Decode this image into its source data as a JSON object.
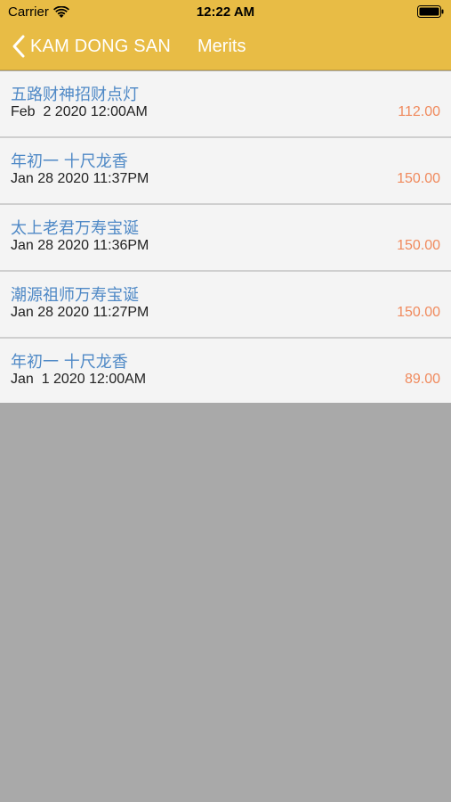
{
  "status_bar": {
    "carrier": "Carrier",
    "time": "12:22 AM"
  },
  "nav": {
    "back_label": "KAM DONG SAN",
    "title": "Merits"
  },
  "colors": {
    "header": "#e8bc45",
    "title_text": "#4f89c6",
    "amount_text": "#f08a5d",
    "row_bg": "#f4f4f4",
    "empty_bg": "#a9a9a9"
  },
  "merits": [
    {
      "title": "五路财神招财点灯",
      "date": "Feb  2 2020 12:00AM",
      "amount": "112.00"
    },
    {
      "title": "年初一 十尺龙香",
      "date": "Jan 28 2020 11:37PM",
      "amount": "150.00"
    },
    {
      "title": "太上老君万寿宝诞",
      "date": "Jan 28 2020 11:36PM",
      "amount": "150.00"
    },
    {
      "title": "潮源祖师万寿宝诞",
      "date": "Jan 28 2020 11:27PM",
      "amount": "150.00"
    },
    {
      "title": "年初一 十尺龙香",
      "date": "Jan  1 2020 12:00AM",
      "amount": "89.00"
    }
  ]
}
